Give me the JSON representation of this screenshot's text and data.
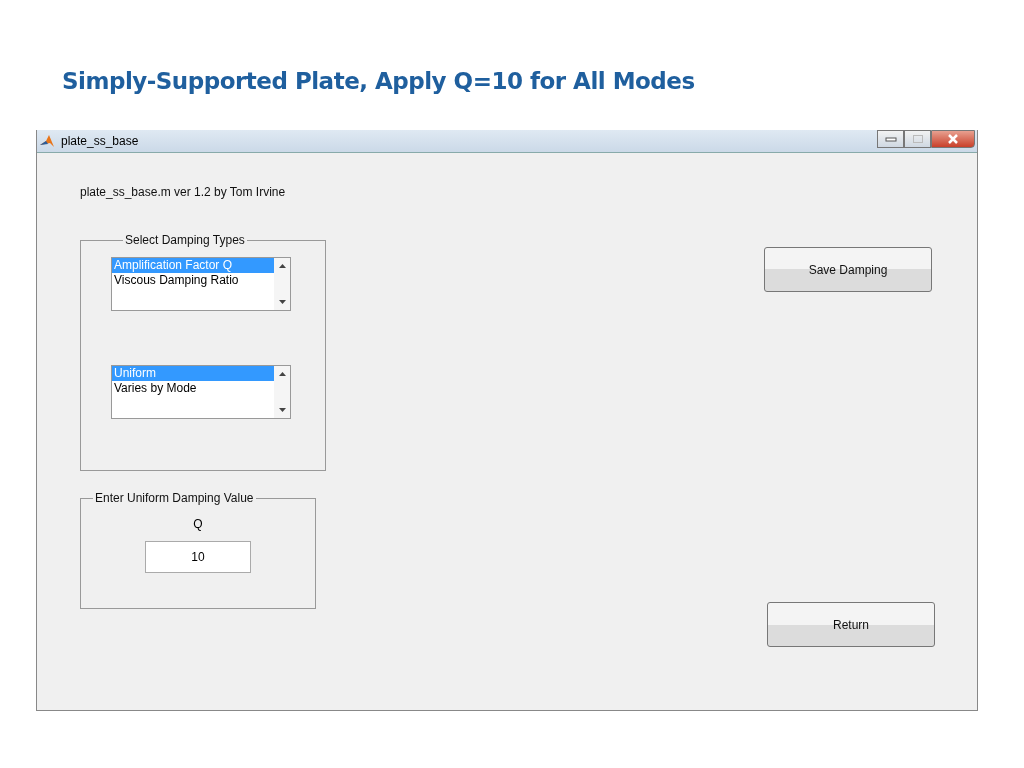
{
  "slide": {
    "title": "Simply-Supported Plate,  Apply Q=10  for All Modes"
  },
  "window": {
    "title": "plate_ss_base"
  },
  "version_text": "plate_ss_base.m  ver 1.2  by Tom Irvine",
  "damping_types": {
    "title": "Select Damping Types",
    "lists": [
      [
        {
          "label": "Amplification Factor Q",
          "selected": true
        },
        {
          "label": "Viscous Damping Ratio",
          "selected": false
        }
      ],
      [
        {
          "label": "Uniform",
          "selected": true
        },
        {
          "label": "Varies by Mode",
          "selected": false
        }
      ]
    ]
  },
  "uniform_value": {
    "title": "Enter Uniform Damping Value",
    "label": "Q",
    "value": "10"
  },
  "buttons": {
    "save": "Save Damping",
    "return": "Return"
  }
}
